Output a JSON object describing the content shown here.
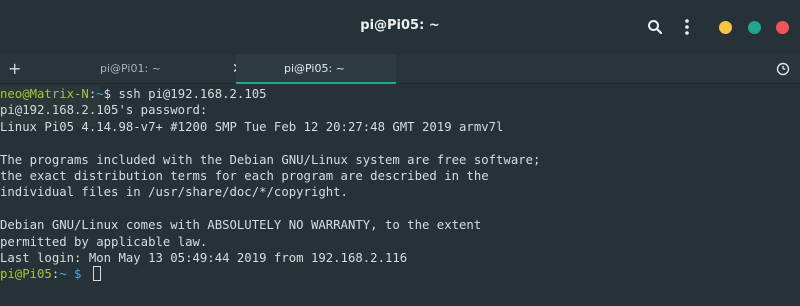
{
  "window": {
    "title": "pi@Pi05: ~"
  },
  "tabs": [
    {
      "label": "pi@Pi01: ~"
    },
    {
      "label": "pi@Pi05: ~"
    }
  ],
  "tabbar": {
    "new_tab": "+",
    "close": "✕"
  },
  "colors": {
    "background": "#263238",
    "accent": "#1fa68f",
    "minimize": "#f6c344",
    "maximize": "#1fa68f",
    "close": "#f2545b",
    "prompt_user": "#a7c73b",
    "prompt_path": "#4aa9e9"
  },
  "icons": [
    "search-icon",
    "menu-icon",
    "clock-icon"
  ],
  "terminal": {
    "l1_user": "neo@Matrix-N",
    "l1_sep": ":",
    "l1_path": "~",
    "l1_cmd": "$ ssh pi@192.168.2.105",
    "l2": "pi@192.168.2.105's password:",
    "l3": "Linux Pi05 4.14.98-v7+ #1200 SMP Tue Feb 12 20:27:48 GMT 2019 armv7l",
    "l5": "The programs included with the Debian GNU/Linux system are free software;",
    "l6": "the exact distribution terms for each program are described in the",
    "l7": "individual files in /usr/share/doc/*/copyright.",
    "l9": "Debian GNU/Linux comes with ABSOLUTELY NO WARRANTY, to the extent",
    "l10": "permitted by applicable law.",
    "l11": "Last login: Mon May 13 05:49:44 2019 from 192.168.2.116",
    "l12_user": "pi@Pi05",
    "l12_sep": ":",
    "l12_path": "~",
    "l12_dollar": " $ "
  }
}
